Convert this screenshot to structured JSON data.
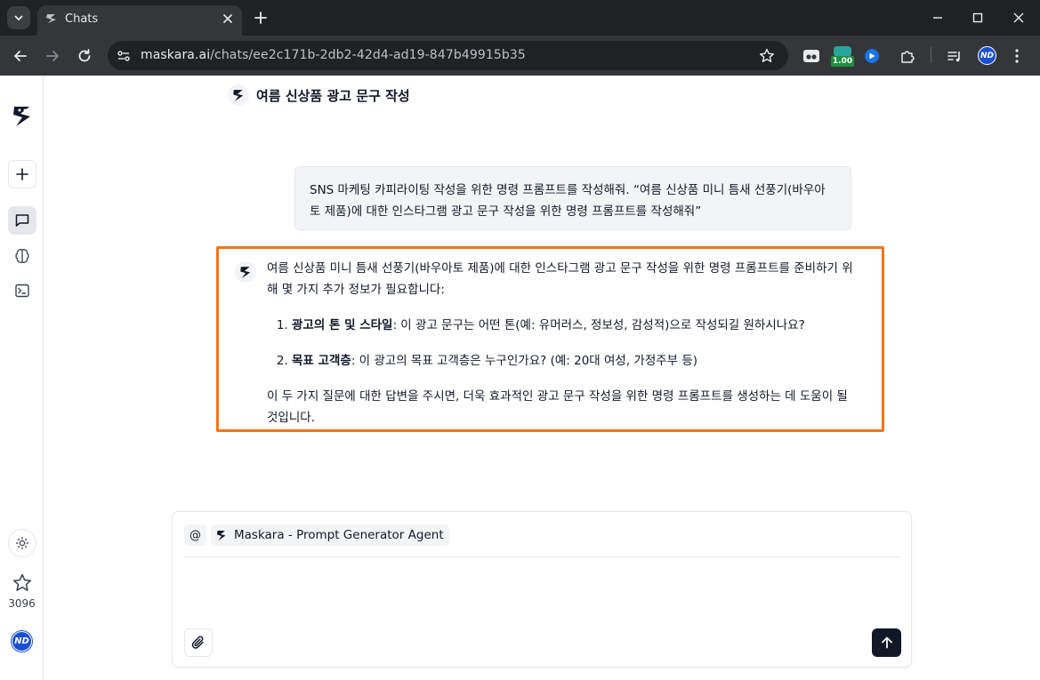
{
  "browser": {
    "tab_title": "Chats",
    "url_host": "maskara.ai",
    "url_path": "/chats/ee2c171b-2db2-42d4-ad19-847b49915b35",
    "extension_badge": "1.00",
    "profile_initials": "ND"
  },
  "sidebar": {
    "star_count": "3096",
    "avatar_initials": "ND"
  },
  "chat": {
    "title": "여름 신상품 광고 문구 작성",
    "user_message": "SNS 마케팅 카피라이팅 작성을 위한 명령 프롬프트를 작성해줘. “여름 신상품 미니 틈새 선풍기(바우아토 제품)에 대한  인스타그램 광고 문구 작성을 위한 명령 프롬프트를 작성해줘”",
    "assistant": {
      "intro": "여름 신상품 미니 틈새 선풍기(바우아토 제품)에 대한 인스타그램 광고 문구 작성을 위한 명령 프롬프트를 준비하기 위해 몇 가지 추가 정보가 필요합니다:",
      "items": [
        {
          "label": "광고의 톤 및 스타일",
          "text": ": 이 광고 문구는 어떤 톤(예: 유머러스, 정보성, 감성적)으로 작성되길 원하시나요?"
        },
        {
          "label": "목표 고객층",
          "text": ": 이 광고의 목표 고객층은 누구인가요? (예: 20대 여성, 가정주부 등)"
        }
      ],
      "outro": "이 두 가지 질문에 대한 답변을 주시면, 더욱 효과적인 광고 문구 작성을 위한 명령 프롬프트를 생성하는 데 도움이 될 것입니다."
    }
  },
  "composer": {
    "mention_symbol": "@",
    "agent_name": "Maskara - Prompt Generator Agent",
    "placeholder": ""
  },
  "colors": {
    "highlight": "#f97316",
    "send_button": "#111827",
    "profile": "#1a4fd6"
  }
}
